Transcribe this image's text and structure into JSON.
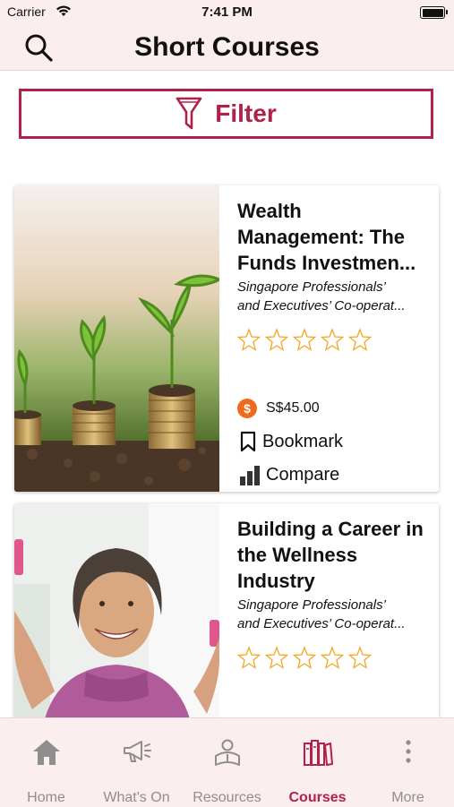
{
  "status": {
    "carrier": "Carrier",
    "time": "7:41 PM"
  },
  "header": {
    "title": "Short Courses"
  },
  "filter": {
    "label": "Filter"
  },
  "courses": [
    {
      "title": "Wealth Management: The Funds Investmen...",
      "provider_line1": "Singapore Professionals’",
      "provider_line2": "and Executives’ Co-operat...",
      "rating": 0,
      "price": "S$45.00",
      "bookmark_label": "Bookmark",
      "compare_label": "Compare"
    },
    {
      "title": "Building a Career in the Wellness Industry",
      "provider_line1": "Singapore Professionals’",
      "provider_line2": "and Executives’ Co-operat...",
      "rating": 0
    }
  ],
  "tabs": [
    {
      "label": "Home",
      "icon": "home-icon"
    },
    {
      "label": "What's On",
      "icon": "megaphone-icon"
    },
    {
      "label": "Resources",
      "icon": "reader-icon"
    },
    {
      "label": "Courses",
      "icon": "books-icon",
      "active": true
    },
    {
      "label": "More",
      "icon": "more-vertical-icon"
    }
  ],
  "colors": {
    "accent": "#b1214a",
    "header_bg": "#fbeeee",
    "price_coin": "#f06a1b",
    "star": "#f5a623"
  }
}
